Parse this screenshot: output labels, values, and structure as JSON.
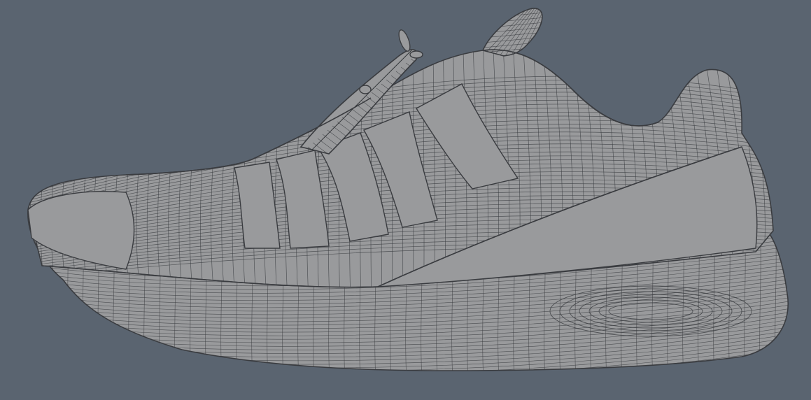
{
  "viewport": {
    "background": "#5a6470",
    "model_fill": "#999a9c",
    "wire_color": "#3a3c40",
    "subject": "shoe-wireframe-mesh",
    "view": "side-profile"
  }
}
